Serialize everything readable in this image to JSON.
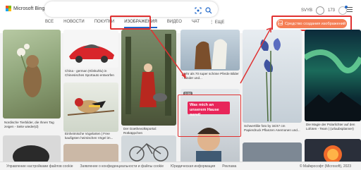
{
  "logo": {
    "text": "Microsoft Bing"
  },
  "search": {
    "value": "",
    "placeholder": ""
  },
  "user": {
    "name": "SVYB",
    "points": "173"
  },
  "tabs": [
    {
      "label": "ВСЕ"
    },
    {
      "label": "НОВОСТИ"
    },
    {
      "label": "ПОКУПКИ"
    },
    {
      "label": "ИЗОБРАЖЕНИЯ"
    },
    {
      "label": "ВИДЕО"
    },
    {
      "label": "ЧАТ"
    },
    {
      "label": "⋮ ЕЩЕ"
    }
  ],
  "create_button": {
    "label": "Средство создания изображений"
  },
  "captions": {
    "c1": "Nordische Tierbilder, die Ihnen Tag zeigen - Seite wieder(d)",
    "c2": "China - german (Klinkuhlu) in Chinesisches Sportauto entworfen",
    "c3": "Einheimische Vogelarten | Free kaufigsten heimischen Vögel im...",
    "c4": "Der Goethevolksportal: Rotkäppchen",
    "c5": "Mehr als 70 super schöne Pferde Bilder - Kinder und...",
    "c6": "Schwertlilie foto by 34/47 cm Papierdruck Pflanzen Anemonen und...",
    "c7": "Die Magie der Polarlichter auf den Lofoten - Team | (urlaubsplanner)"
  },
  "video": {
    "time": "0:00",
    "headline": "Was mich an unserem Hause nervt!"
  },
  "footer": {
    "links": [
      "Управление настройками файлов cookie",
      "Заявление о конфиденциальности и файлы cookie",
      "Юридическая информация",
      "Реклама"
    ],
    "copyright": "© Майкрософт (Microsoft), 2023"
  }
}
